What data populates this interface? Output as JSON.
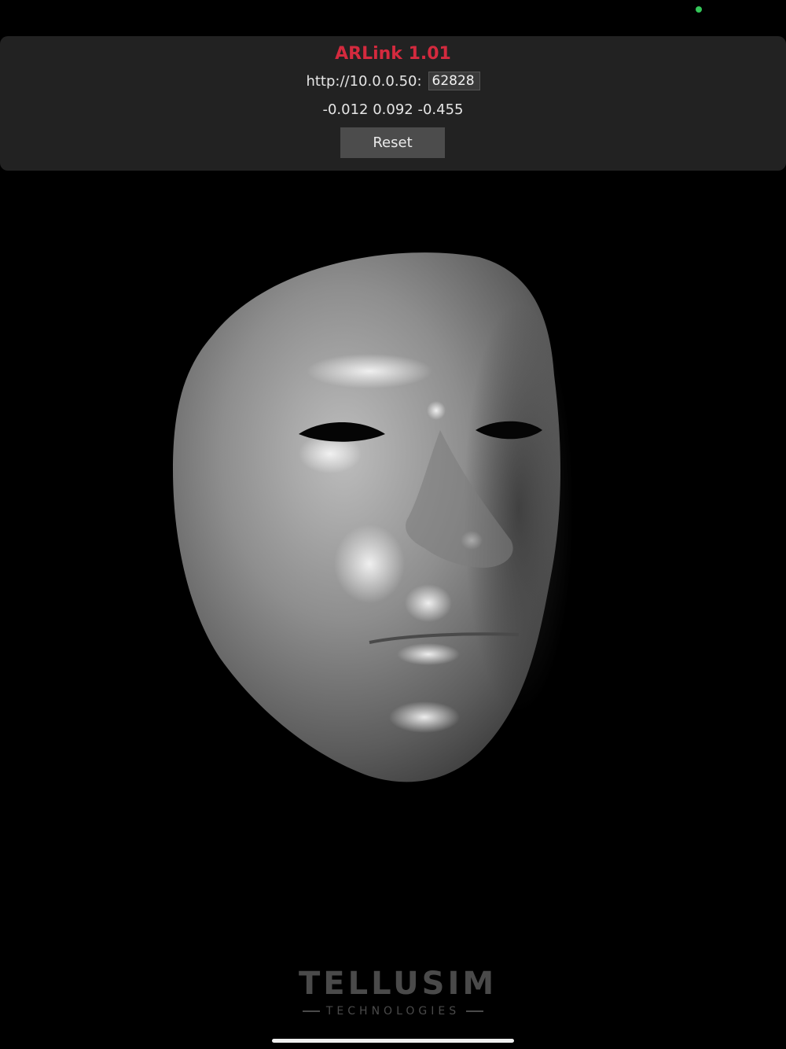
{
  "status": {
    "indicator_color": "#34c759"
  },
  "panel": {
    "title": "ARLink 1.01",
    "title_color": "#d42a3e",
    "url_label": "http://10.0.0.50:",
    "port_value": "62828",
    "coordinates": "-0.012 0.092 -0.455",
    "reset_label": "Reset"
  },
  "viewport": {
    "content": "3d-face-mesh"
  },
  "logo": {
    "main": "TELLUSIM",
    "sub": "TECHNOLOGIES"
  }
}
